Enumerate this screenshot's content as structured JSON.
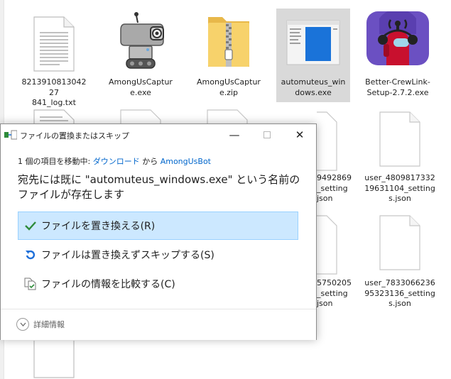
{
  "files_row1": [
    {
      "name": "821391081304227841_log.txt",
      "line1": "821391081304227",
      "line2": "841_log.txt",
      "icon": "text-file-icon"
    },
    {
      "name": "AmongUsCapture.exe",
      "line1": "AmongUsCaptur",
      "line2": "e.exe",
      "icon": "robot-app-icon"
    },
    {
      "name": "AmongUsCapture.zip",
      "line1": "AmongUsCaptur",
      "line2": "e.zip",
      "icon": "zip-folder-icon"
    },
    {
      "name": "automuteus_windows.exe",
      "line1": "automuteus_win",
      "line2": "dows.exe",
      "icon": "window-app-icon"
    },
    {
      "name": "Better-CrewLink-Setup-2.7.2.exe",
      "line1": "Better-CrewLink-",
      "line2": "Setup-2.7.2.exe",
      "icon": "crewlink-app-icon"
    }
  ],
  "files_partial": [
    {
      "line1": "9492869",
      "line2": "_setting",
      "line3": "json"
    },
    {
      "line1": "5750205",
      "line2": "_setting",
      "line3": "json"
    }
  ],
  "files_right": [
    {
      "line1": "user_4809817332",
      "line2": "19631104_setting",
      "line3": "s.json"
    },
    {
      "line1": "user_7833066236",
      "line2": "95323136_setting",
      "line3": "s.json"
    }
  ],
  "dialog": {
    "title": "ファイルの置換またはスキップ",
    "move_prefix": "1 個の項目を移動中: ",
    "move_source": "ダウンロード",
    "move_middle": " から ",
    "move_dest": "AmongUsBot",
    "message": "宛先には既に \"automuteus_windows.exe\" という名前のファイルが存在します",
    "options": [
      {
        "label": "ファイルを置き換える(R)",
        "icon": "checkmark-icon"
      },
      {
        "label": "ファイルは置き換えずスキップする(S)",
        "icon": "skip-arrow-icon"
      },
      {
        "label": "ファイルの情報を比較する(C)",
        "icon": "compare-files-icon"
      }
    ],
    "details_label": "詳細情報"
  },
  "colors": {
    "accent": "#0066cc",
    "highlight_bg": "#cce8ff",
    "highlight_border": "#99d1ff",
    "selected_tile": "#d9d9d9",
    "check_green": "#2e8b3a",
    "skip_blue": "#1e6fd9"
  }
}
